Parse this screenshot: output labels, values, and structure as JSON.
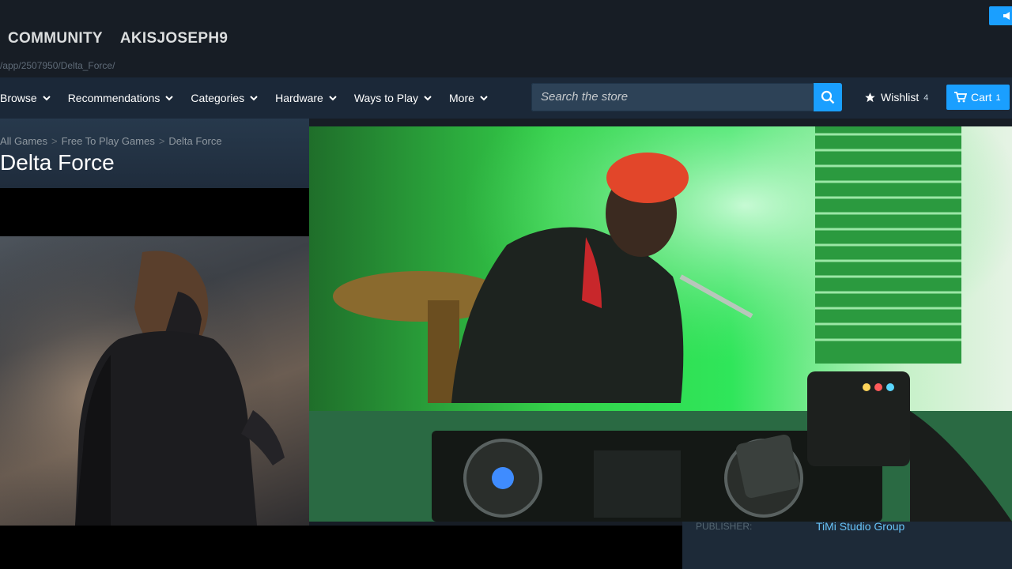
{
  "header": {
    "community": "COMMUNITY",
    "username": "AKISJOSEPH9",
    "url": "/app/2507950/Delta_Force/"
  },
  "store_menu": {
    "items": [
      {
        "label": "Browse"
      },
      {
        "label": "Recommendations"
      },
      {
        "label": "Categories"
      },
      {
        "label": "Hardware"
      },
      {
        "label": "Ways to Play"
      },
      {
        "label": "More"
      }
    ]
  },
  "search": {
    "placeholder": "Search the store"
  },
  "wishlist": {
    "label": "Wishlist",
    "count": "4"
  },
  "cart": {
    "label": "Cart",
    "count": "1"
  },
  "breadcrumb": {
    "items": [
      "All Games",
      "Free To Play Games",
      "Delta Force"
    ],
    "separator": ">"
  },
  "game": {
    "title": "Delta Force"
  },
  "details": {
    "publisher_label": "PUBLISHER:",
    "publisher_value": "TiMi Studio Group"
  },
  "icons": {
    "notification": "megaphone-icon",
    "search": "search-icon",
    "wishlist": "star-icon",
    "cart": "cart-icon",
    "dropdown": "chevron-down-icon"
  },
  "colors": {
    "accent": "#1a9fff",
    "link": "#67c1f5",
    "nav_bg": "#1b2838",
    "page_bg": "#171d25"
  }
}
